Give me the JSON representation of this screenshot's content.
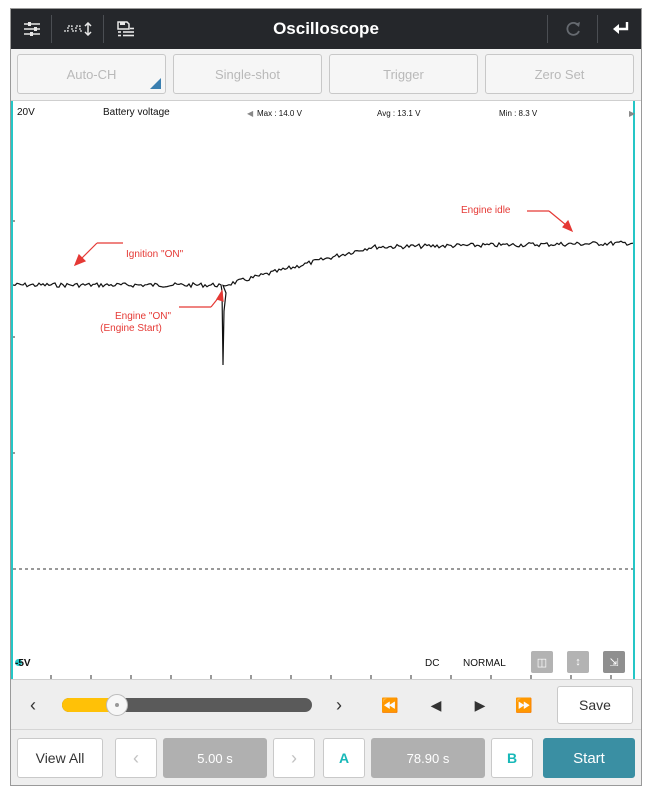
{
  "titlebar": {
    "title": "Oscilloscope",
    "icons": [
      "sliders-icon",
      "waveform-settings-icon",
      "save-list-icon",
      "refresh-icon",
      "back-arrow-icon"
    ]
  },
  "functions": {
    "auto_ch": "Auto-CH",
    "single_shot": "Single-shot",
    "trigger": "Trigger",
    "zero_set": "Zero Set"
  },
  "scope": {
    "scale_top": "20V",
    "channel_name": "Battery voltage",
    "max": "Max : 14.0 V",
    "avg": "Avg : 13.1 V",
    "min": "Min :  8.3 V",
    "scale_bottom": "-5V",
    "coupling": "DC",
    "mode": "NORMAL",
    "annotations": {
      "ignition_on": "Ignition \"ON\"",
      "engine_on_line1": "Engine \"ON\"",
      "engine_on_line2": "(Engine Start)",
      "engine_idle": "Engine idle"
    }
  },
  "playback": {
    "progress": 0.22,
    "save": "Save"
  },
  "bottom": {
    "view_all": "View All",
    "time_div": "5.00 s",
    "cursor_a": "A",
    "cursor_value": "78.90 s",
    "cursor_b": "B",
    "start": "Start"
  },
  "colors": {
    "accent_cyan": "#25c6c6",
    "annotation_red": "#e53935",
    "start_button": "#3a8fa3",
    "slider_fill": "#ffc107"
  }
}
